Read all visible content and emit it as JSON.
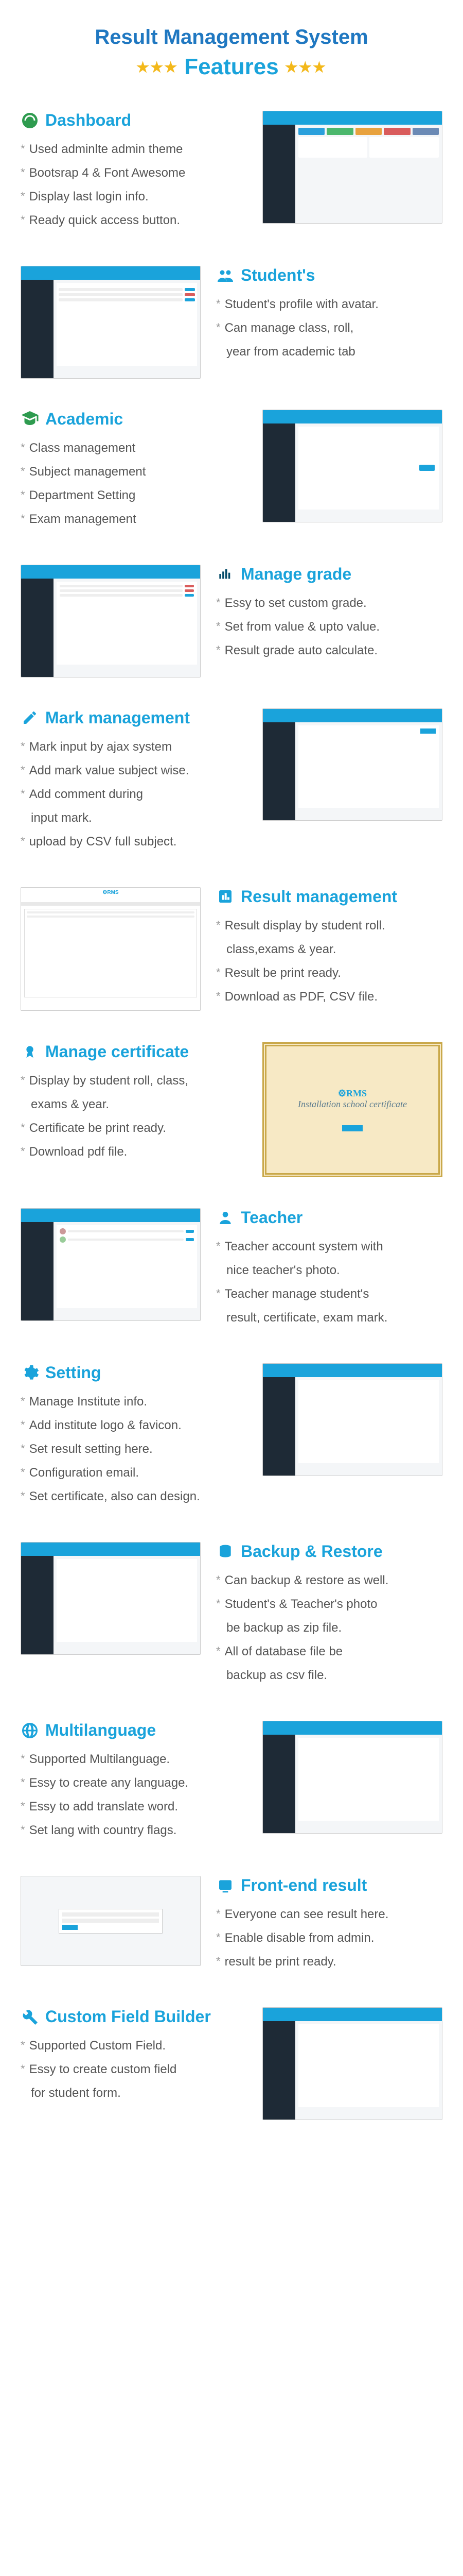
{
  "header": {
    "title": "Result Management System",
    "subtitle": "Features",
    "stars": "★★★"
  },
  "dashboard": {
    "title": "Dashboard",
    "i1": "Used adminlte admin theme",
    "i2": "Bootsrap 4 & Font Awesome",
    "i3": "Display last login info.",
    "i4": "Ready quick access button."
  },
  "students": {
    "title": "Student's",
    "i1": "Student's profile with avatar.",
    "i2": "Can manage class, roll,",
    "i3": "year from academic tab"
  },
  "academic": {
    "title": "Academic",
    "i1": "Class management",
    "i2": "Subject management",
    "i3": "Department Setting",
    "i4": "Exam management"
  },
  "grade": {
    "title": "Manage grade",
    "i1": "Essy to set custom grade.",
    "i2": "Set from value & upto value.",
    "i3": "Result grade auto calculate."
  },
  "mark": {
    "title": "Mark management",
    "i1": "Mark input by ajax system",
    "i2": "Add mark value subject wise.",
    "i3": "Add comment during",
    "i3b": "input mark.",
    "i4": "upload by CSV full subject."
  },
  "result": {
    "title": "Result management",
    "i1": "Result display by student roll.",
    "i1b": "class,exams & year.",
    "i2": "Result be print ready.",
    "i3": "Download as PDF, CSV file."
  },
  "certificate": {
    "title": "Manage certificate",
    "i1": "Display by student roll, class,",
    "i1b": "exams & year.",
    "i2": "Certificate be print ready.",
    "i3": "Download pdf file."
  },
  "teacher": {
    "title": "Teacher",
    "i1": "Teacher account system with",
    "i1b": "nice teacher's photo.",
    "i2": "Teacher manage student's",
    "i2b": "result, certificate, exam mark."
  },
  "setting": {
    "title": "Setting",
    "i1": "Manage Institute info.",
    "i2": "Add institute logo & favicon.",
    "i3": "Set result setting here.",
    "i4": "Configuration email.",
    "i5": "Set certificate, also can design."
  },
  "backup": {
    "title": "Backup & Restore",
    "i1": "Can backup & restore as well.",
    "i2": "Student's & Teacher's photo",
    "i2b": "be backup as zip file.",
    "i3": "All of database file be",
    "i3b": "backup as csv file."
  },
  "multilang": {
    "title": "Multilanguage",
    "i1": "Supported Multilanguage.",
    "i2": "Essy to create any language.",
    "i3": "Essy to add translate word.",
    "i4": "Set lang with country flags."
  },
  "frontend": {
    "title": "Front-end result",
    "i1": "Everyone can see result here.",
    "i2": "Enable disable from admin.",
    "i3": "result be print ready."
  },
  "custom": {
    "title": "Custom Field Builder",
    "i1": "Supported Custom Field.",
    "i2": "Essy to create custom field",
    "i2b": "for student form."
  },
  "cert_text": "Installation school certificate"
}
